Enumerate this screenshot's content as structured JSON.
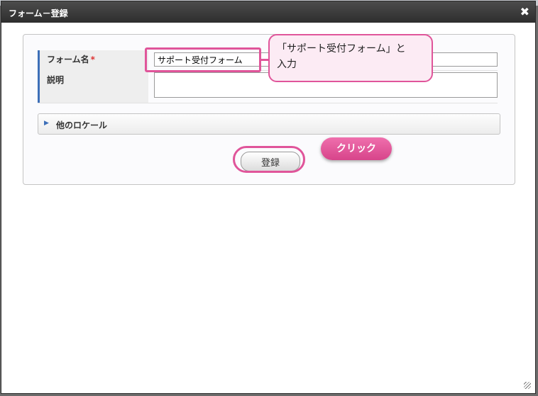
{
  "dialog": {
    "title": "フォーム－登録",
    "close_glyph": "✖"
  },
  "form": {
    "name_label": "フォーム名",
    "required_mark": "*",
    "name_value": "サポート受付フォーム",
    "description_label": "説明",
    "description_value": "",
    "locale_arrow": "▶",
    "locale_label": "他のロケール",
    "submit_label": "登録"
  },
  "annotations": {
    "input_note_line1": "「サポート受付フォーム」と",
    "input_note_line2": "入力",
    "click_note": "クリック"
  },
  "colors": {
    "annotation_pink": "#e0559a",
    "accent_blue": "#3d6fb8",
    "titlebar": "#3a3a3a"
  }
}
